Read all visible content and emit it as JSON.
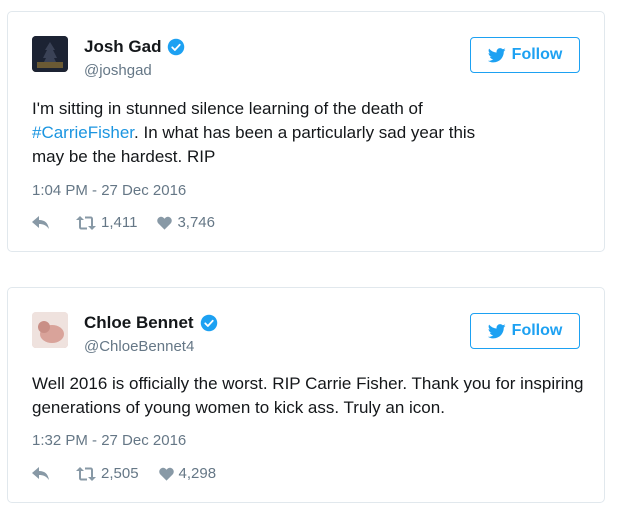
{
  "tweets": [
    {
      "name": "Josh Gad",
      "handle": "@joshgad",
      "follow_label": "Follow",
      "text_before": "I'm sitting in stunned silence learning of the death of ",
      "hashtag": "#CarrieFisher",
      "text_after": ". In what has been a particularly sad year this may be the hardest. RIP",
      "timestamp": "1:04 PM - 27 Dec 2016",
      "retweets": "1,411",
      "likes": "3,746"
    },
    {
      "name": "Chloe Bennet",
      "handle": "@ChloeBennet4",
      "follow_label": "Follow",
      "text": "Well 2016 is officially the worst. RIP Carrie Fisher. Thank you for inspiring generations of young women to kick ass. Truly an icon.",
      "timestamp": "1:32 PM - 27 Dec 2016",
      "retweets": "2,505",
      "likes": "4,298"
    }
  ],
  "colors": {
    "accent": "#1da1f2",
    "hashtag": "#1b95e0",
    "muted": "#657786",
    "border": "#e1e8ed"
  },
  "icons": [
    "verified-badge-icon",
    "twitter-bird-icon",
    "reply-icon",
    "retweet-icon",
    "heart-icon"
  ]
}
